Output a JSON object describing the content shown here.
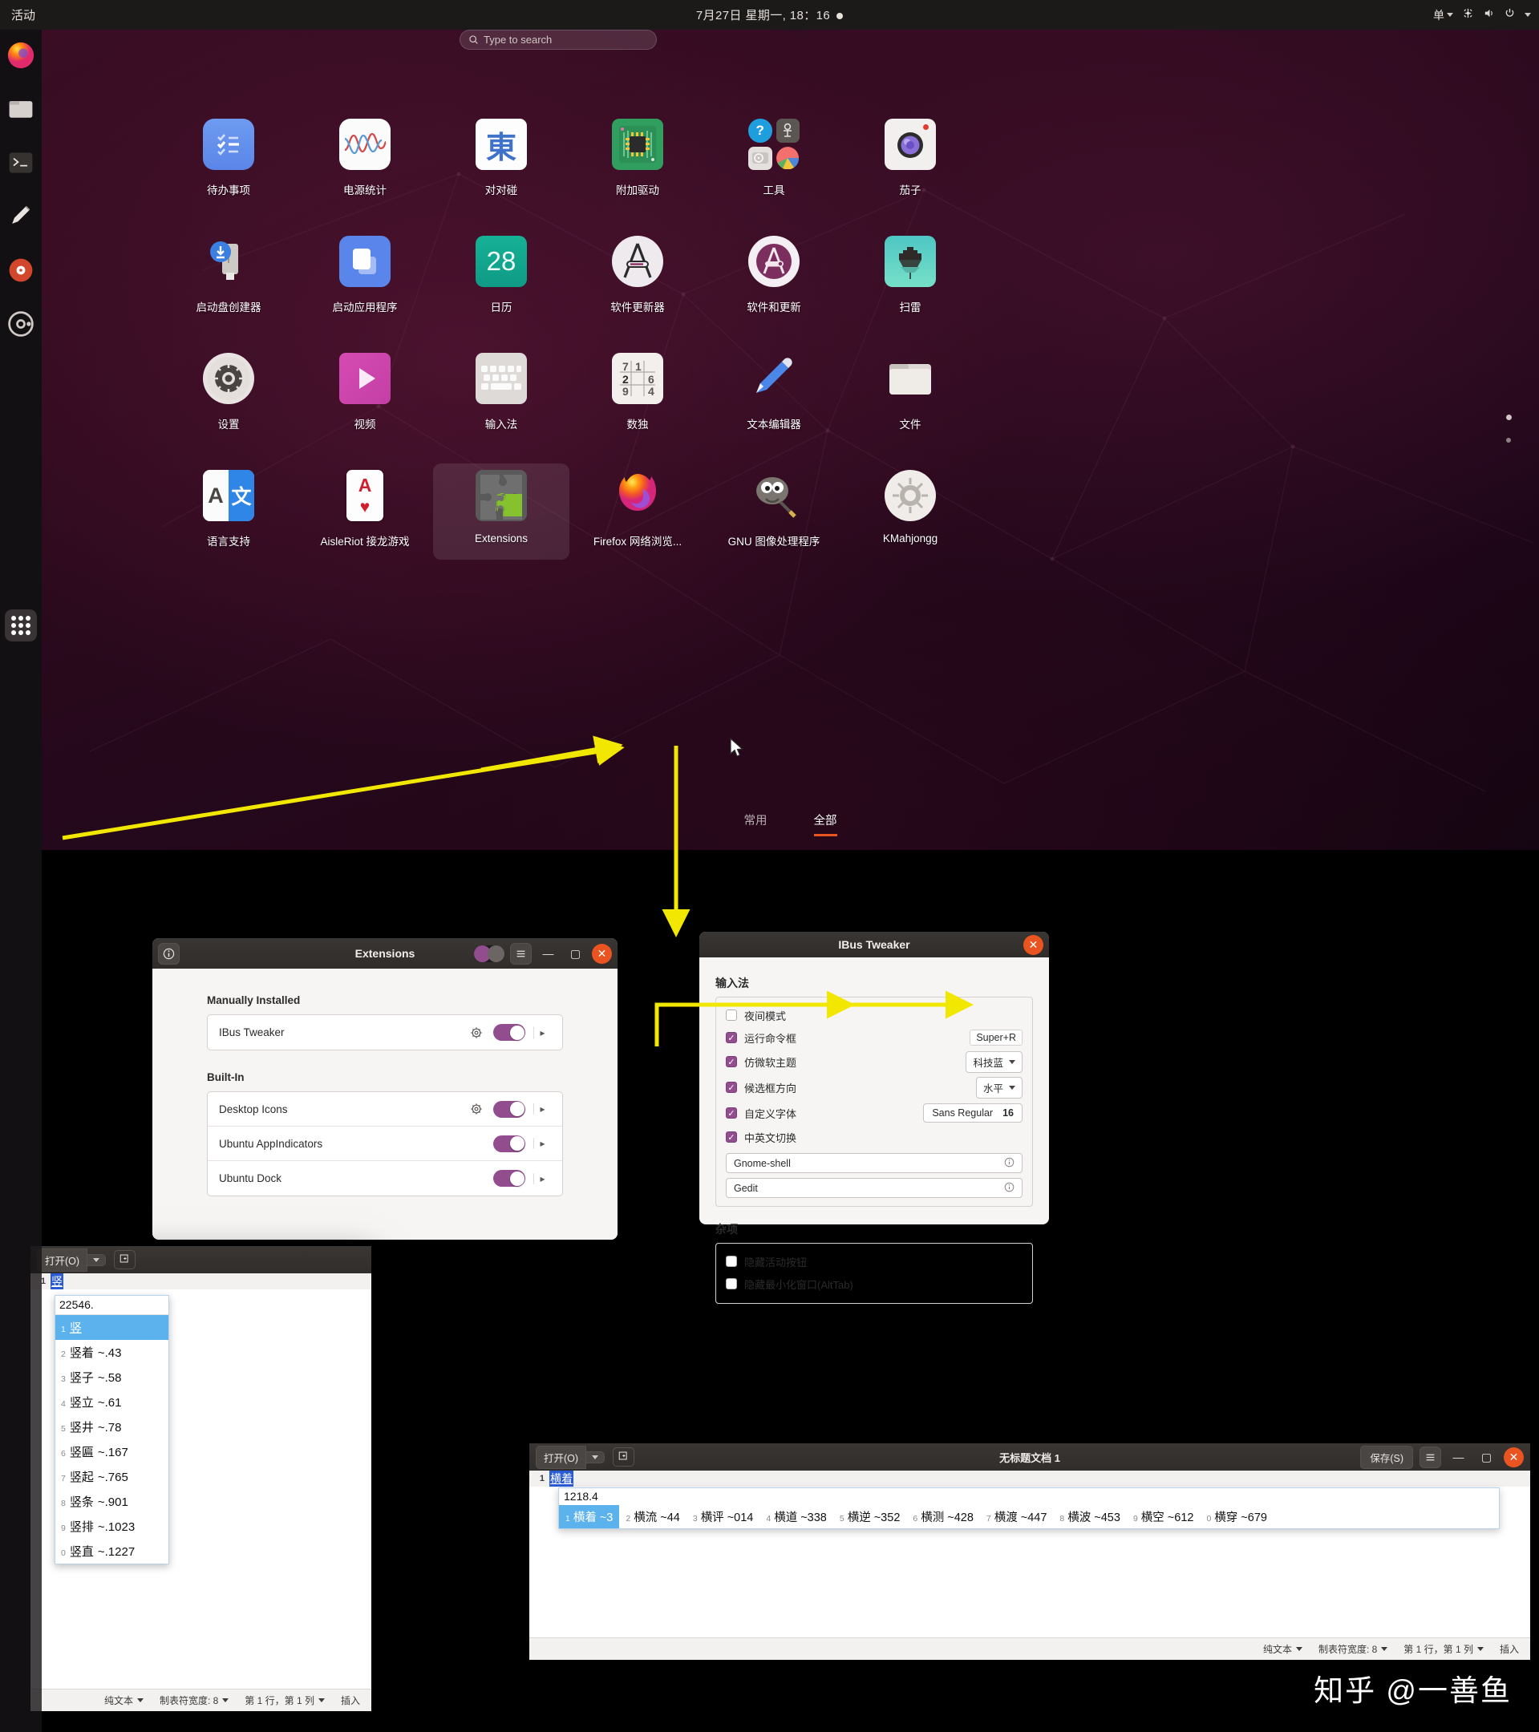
{
  "topbar": {
    "activities": "活动",
    "clock": "7月27日 星期一, 18：16",
    "input_method": "单",
    "icons": [
      "network-icon",
      "volume-icon",
      "power-icon",
      "chevron-down-icon"
    ]
  },
  "dock": {
    "items": [
      {
        "name": "firefox",
        "label": "Firefox"
      },
      {
        "name": "files",
        "label": "文件"
      },
      {
        "name": "terminal",
        "label": "终端"
      },
      {
        "name": "text-editor",
        "label": "文本编辑器"
      },
      {
        "name": "rhythmbox",
        "label": "Rhythmbox"
      },
      {
        "name": "ubuntu-software",
        "label": "Ubuntu 软件"
      }
    ],
    "show_apps_label": "显示应用程序"
  },
  "overview": {
    "search": {
      "placeholder": "Type to search",
      "icon": "search-icon"
    },
    "tabs": [
      {
        "label": "常用",
        "active": false
      },
      {
        "label": "全部",
        "active": true
      }
    ],
    "apps": [
      [
        {
          "label": "待办事项",
          "icon": "todo-icon"
        },
        {
          "label": "电源统计",
          "icon": "power-statistics-icon"
        },
        {
          "label": "对对碰",
          "icon": "mahjongg-match-icon"
        },
        {
          "label": "附加驱动",
          "icon": "additional-drivers-icon"
        },
        {
          "label": "工具",
          "icon": "utilities-folder-icon"
        },
        {
          "label": "茄子",
          "icon": "cheese-camera-icon"
        }
      ],
      [
        {
          "label": "启动盘创建器",
          "icon": "usb-creator-icon"
        },
        {
          "label": "启动应用程序",
          "icon": "startup-applications-icon"
        },
        {
          "label": "日历",
          "icon": "calendar-icon"
        },
        {
          "label": "软件更新器",
          "icon": "software-updater-icon"
        },
        {
          "label": "软件和更新",
          "icon": "software-and-updates-icon"
        },
        {
          "label": "扫雷",
          "icon": "mines-icon"
        }
      ],
      [
        {
          "label": "设置",
          "icon": "settings-gear-icon"
        },
        {
          "label": "视频",
          "icon": "videos-icon"
        },
        {
          "label": "输入法",
          "icon": "input-method-keyboard-icon"
        },
        {
          "label": "数独",
          "icon": "sudoku-icon"
        },
        {
          "label": "文本编辑器",
          "icon": "text-editor-pencil-icon"
        },
        {
          "label": "文件",
          "icon": "files-folder-icon"
        }
      ],
      [
        {
          "label": "语言支持",
          "icon": "language-support-icon"
        },
        {
          "label": "AisleRiot 接龙游戏",
          "icon": "aisleriot-cards-icon"
        },
        {
          "label": "Extensions",
          "icon": "extensions-puzzle-icon",
          "highlight": true
        },
        {
          "label": "Firefox 网络浏览...",
          "icon": "firefox-icon"
        },
        {
          "label": "GNU 图像处理程序",
          "icon": "gimp-icon"
        },
        {
          "label": "KMahjongg",
          "icon": "kmahjongg-icon"
        }
      ]
    ]
  },
  "extensions_window": {
    "title": "Extensions",
    "info_icon": "info-icon",
    "menu_icon": "hamburger-menu-icon",
    "minimize_label": "—",
    "maximize_label": "▢",
    "close_label": "✕",
    "sections": [
      {
        "heading": "Manually Installed",
        "rows": [
          {
            "name": "IBus Tweaker",
            "has_gear": true,
            "enabled": true
          }
        ]
      },
      {
        "heading": "Built-In",
        "rows": [
          {
            "name": "Desktop Icons",
            "has_gear": true,
            "enabled": true
          },
          {
            "name": "Ubuntu AppIndicators",
            "has_gear": false,
            "enabled": true
          },
          {
            "name": "Ubuntu Dock",
            "has_gear": false,
            "enabled": true
          }
        ]
      }
    ]
  },
  "ibus_window": {
    "title": "IBus Tweaker",
    "close_label": "✕",
    "sections": [
      {
        "heading": "输入法",
        "rows": [
          {
            "label": "夜间模式",
            "checked": false,
            "control": null
          },
          {
            "label": "运行命令框",
            "checked": true,
            "control": {
              "type": "key",
              "value": "Super+R"
            }
          },
          {
            "label": "仿微软主题",
            "checked": true,
            "control": {
              "type": "dropdown",
              "value": "科技蓝"
            }
          },
          {
            "label": "候选框方向",
            "checked": true,
            "control": {
              "type": "dropdown",
              "value": "水平"
            }
          },
          {
            "label": "自定义字体",
            "checked": true,
            "control": {
              "type": "font",
              "value": "Sans Regular",
              "size": "16"
            }
          },
          {
            "label": "中英文切换",
            "checked": true,
            "control": null
          }
        ],
        "entries": [
          {
            "value": "Gnome-shell",
            "info_icon": "info-circle-icon"
          },
          {
            "value": "Gedit",
            "info_icon": "info-circle-icon"
          }
        ]
      },
      {
        "heading": "杂项",
        "rows": [
          {
            "label": "隐藏活动按钮",
            "checked": false,
            "control": null
          },
          {
            "label": "隐藏最小化窗口(AltTab)",
            "checked": false,
            "control": null
          }
        ],
        "entries": []
      }
    ]
  },
  "gedit_left": {
    "open_label": "打开(O)",
    "new_tab_icon": "new-tab-icon",
    "line_number": "1",
    "preedit": "竖",
    "status": {
      "language": "纯文本",
      "tab_width": "制表符宽度: 8",
      "position": "第 1 行，第 1 列",
      "mode": "插入"
    },
    "candidates": {
      "aux": "22546.",
      "items": [
        {
          "idx": "1",
          "text": "竖",
          "code": "",
          "selected": true
        },
        {
          "idx": "2",
          "text": "竖着",
          "code": "~.43",
          "selected": false
        },
        {
          "idx": "3",
          "text": "竖子",
          "code": "~.58",
          "selected": false
        },
        {
          "idx": "4",
          "text": "竖立",
          "code": "~.61",
          "selected": false
        },
        {
          "idx": "5",
          "text": "竖井",
          "code": "~.78",
          "selected": false
        },
        {
          "idx": "6",
          "text": "竖匾",
          "code": "~.167",
          "selected": false
        },
        {
          "idx": "7",
          "text": "竖起",
          "code": "~.765",
          "selected": false
        },
        {
          "idx": "8",
          "text": "竖条",
          "code": "~.901",
          "selected": false
        },
        {
          "idx": "9",
          "text": "竖排",
          "code": "~.1023",
          "selected": false
        },
        {
          "idx": "0",
          "text": "竖直",
          "code": "~.1227",
          "selected": false
        }
      ]
    }
  },
  "gedit_right": {
    "open_label": "打开(O)",
    "new_tab_icon": "new-tab-icon",
    "title": "无标题文档 1",
    "save_label": "保存(S)",
    "menu_icon": "hamburger-menu-icon",
    "minimize_label": "—",
    "maximize_label": "▢",
    "close_label": "✕",
    "line_number": "1",
    "preedit": "横着",
    "status": {
      "language": "纯文本",
      "tab_width": "制表符宽度: 8",
      "position": "第 1 行，第 1 列",
      "mode": "插入"
    },
    "candidates": {
      "aux": "1218.4",
      "items": [
        {
          "idx": "1",
          "text": "横着",
          "code": "~3",
          "selected": true
        },
        {
          "idx": "2",
          "text": "横流",
          "code": "~44",
          "selected": false
        },
        {
          "idx": "3",
          "text": "横评",
          "code": "~014",
          "selected": false
        },
        {
          "idx": "4",
          "text": "横道",
          "code": "~338",
          "selected": false
        },
        {
          "idx": "5",
          "text": "横逆",
          "code": "~352",
          "selected": false
        },
        {
          "idx": "6",
          "text": "横测",
          "code": "~428",
          "selected": false
        },
        {
          "idx": "7",
          "text": "横渡",
          "code": "~447",
          "selected": false
        },
        {
          "idx": "8",
          "text": "横波",
          "code": "~453",
          "selected": false
        },
        {
          "idx": "9",
          "text": "横空",
          "code": "~612",
          "selected": false
        },
        {
          "idx": "0",
          "text": "横穿",
          "code": "~679",
          "selected": false
        }
      ]
    }
  },
  "watermark": "知乎 @一善鱼",
  "colors": {
    "accent_orange": "#e95420",
    "toggle_purple": "#924d8e",
    "arrow_yellow": "#f2e700",
    "candidate_blue": "#5cb2ec",
    "preedit_blue": "#2a5bd7"
  }
}
